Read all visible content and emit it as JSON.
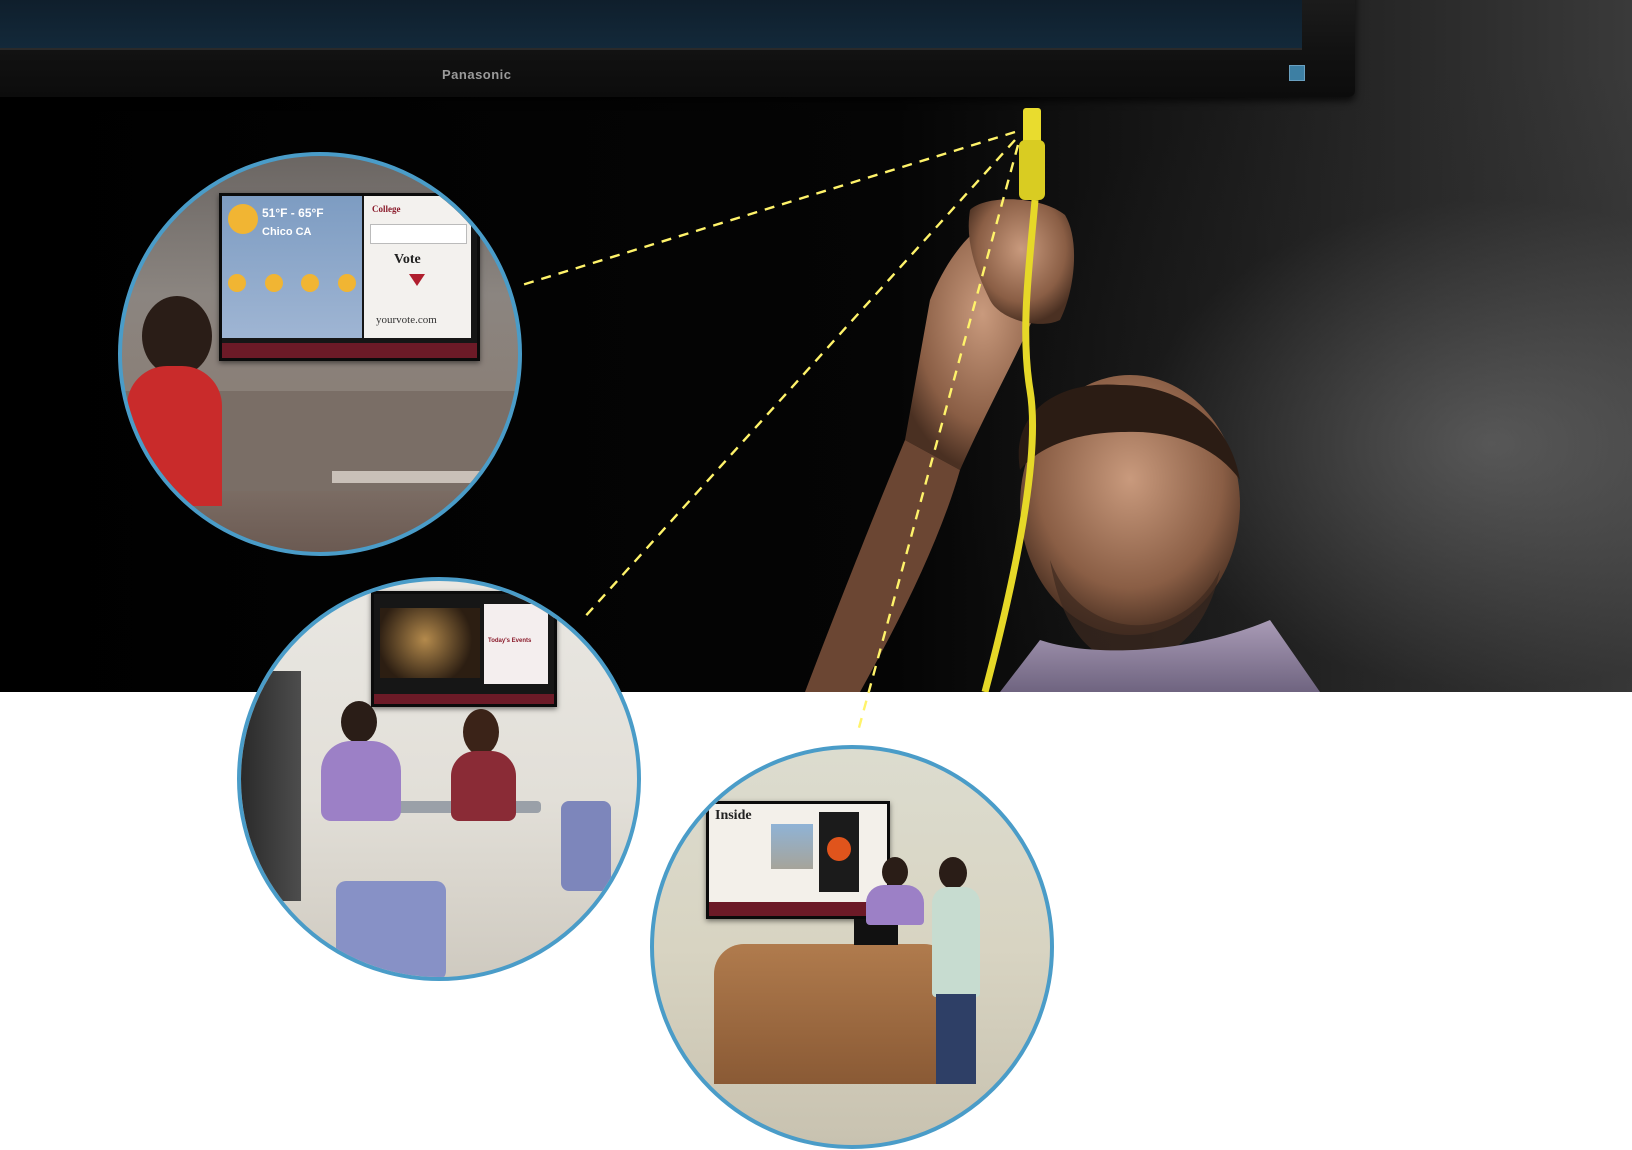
{
  "hero": {
    "tv_brand": "Panasonic"
  },
  "circle1": {
    "weather_temp": "51°F - 65°F",
    "weather_city": "Chico CA",
    "college_label": "College",
    "vote_heading": "Vote",
    "vote_url": "yourvote.com"
  },
  "circle2": {
    "today_events": "Today's Events"
  },
  "circle3": {
    "inside_heading": "Inside"
  },
  "colors": {
    "circle_border": "#4a9cc8",
    "dashed_lines": "#fff36a",
    "cable": "#e6d828",
    "signage_maroon": "#6c1a27"
  }
}
